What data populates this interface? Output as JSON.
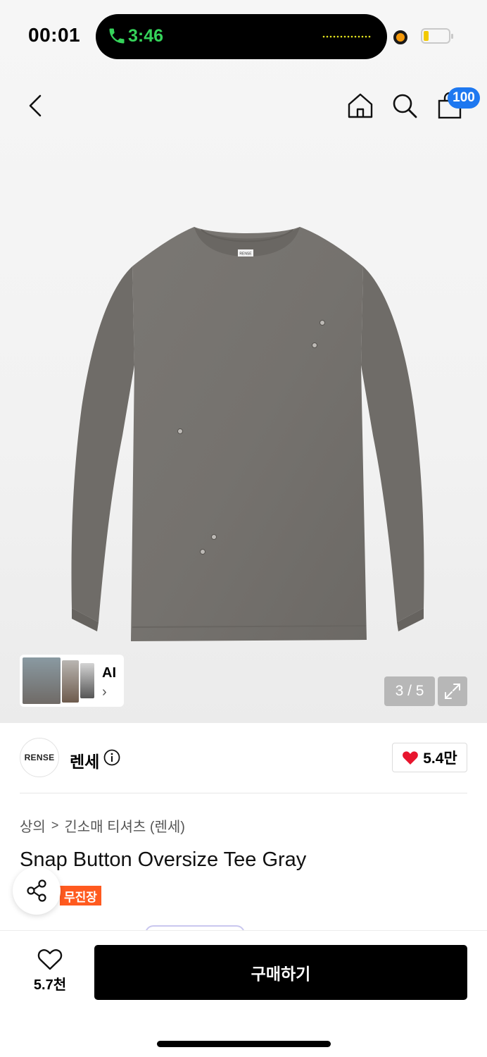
{
  "status_bar": {
    "time": "00:01",
    "call_time": "3:46"
  },
  "nav": {
    "cart_badge": "100"
  },
  "gallery": {
    "counter": "3 / 5",
    "ai_label": "AI",
    "ai_arrow": "›"
  },
  "product_image": {
    "neckline_label": "RENSE"
  },
  "brand": {
    "logo_text": "RENSE",
    "name": "렌세",
    "likes": "5.4만"
  },
  "breadcrumb": {
    "category": "상의",
    "separator": ">",
    "subcategory": "긴소매 티셔츠 (렌세)"
  },
  "product": {
    "title": "Snap Button Oversize Tee Gray",
    "tag": "무진장"
  },
  "bottom_bar": {
    "wish_count": "5.7천",
    "buy_label": "구매하기"
  },
  "colors": {
    "buy_button": "#000000",
    "badge": "#1e78f0",
    "tag": "#ff5a1f",
    "heart": "#e8152e",
    "call_green": "#35d35a"
  },
  "icons": [
    "phone-icon",
    "back-icon",
    "home-icon",
    "search-icon",
    "cart-icon",
    "expand-icon",
    "info-icon",
    "heart-icon",
    "share-icon",
    "heart-outline-icon"
  ]
}
